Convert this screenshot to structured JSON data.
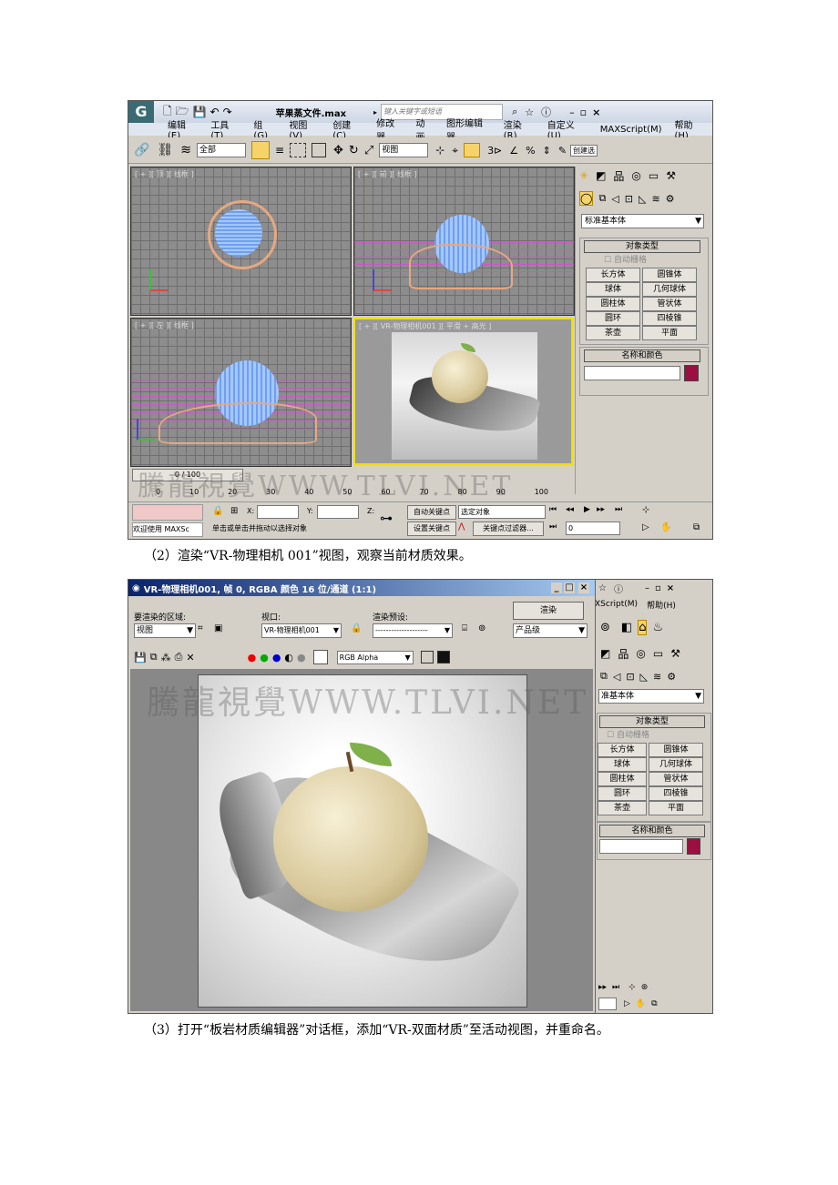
{
  "shot1": {
    "file_title": "苹果蒸文件.max",
    "search_placeholder": "键入关键字或短语",
    "menu": [
      "编辑(E)",
      "工具(T)",
      "组(G)",
      "视图(V)",
      "创建(C)",
      "修改器",
      "动画",
      "图形编辑器",
      "渲染(R)",
      "自定义(U)",
      "MAXScript(M)",
      "帮助(H)"
    ],
    "toolbar": {
      "select_filter": "全部",
      "view_select": "视图",
      "create_selection": "创建选"
    },
    "viewports": {
      "top": "[ + ][ 顶 ][ 线框 ]",
      "front": "[ + ][ 前 ][ 线框 ]",
      "left": "[ + ][ 左 ][ 线框 ]",
      "camera": "[ + ][ VR-物理相机001 ][ 平滑 + 高光 ]"
    },
    "panel": {
      "category": "标准基本体",
      "object_type_title": "对象类型",
      "autogrid": "自动栅格",
      "buttons": [
        "长方体",
        "圆锥体",
        "球体",
        "几何球体",
        "圆柱体",
        "管状体",
        "圆环",
        "四棱锥",
        "茶壶",
        "平面"
      ],
      "name_color_title": "名称和颜色"
    },
    "timeline": {
      "frame": "0 / 100",
      "ticks": [
        "0",
        "10",
        "20",
        "30",
        "40",
        "50",
        "60",
        "70",
        "80",
        "90",
        "100"
      ]
    },
    "status": {
      "welcome": "欢迎使用 MAXSc",
      "prompt": "单击或单击并拖动以选择对象",
      "x_label": "X:",
      "y_label": "Y:",
      "z_label": "Z:",
      "auto_key": "自动关键点",
      "set_key": "设置关键点",
      "selected": "选定对象",
      "key_filters": "关键点过滤器...",
      "frame_value": "0"
    }
  },
  "caption2": "（2）渲染“VR-物理相机 001”视图，观察当前材质效果。",
  "shot2": {
    "window_title": "VR-物理相机001, 帧 0, RGBA 颜色 16 位/通道 (1:1)",
    "render_area_label": "要渲染的区域:",
    "render_area_value": "视图",
    "viewport_label": "视口:",
    "viewport_value": "VR-物理相机001",
    "preset_label": "渲染预设:",
    "preset_value": "--------------------",
    "render_button": "渲染",
    "quality_value": "产品级",
    "channel_value": "RGB Alpha",
    "bg_panel": {
      "menu": [
        "XScript(M)",
        "帮助(H)"
      ],
      "category": "准基本体",
      "object_type_title": "对象类型",
      "autogrid": "自动栅格",
      "buttons": [
        "长方体",
        "圆锥体",
        "球体",
        "几何球体",
        "圆柱体",
        "管状体",
        "圆环",
        "四棱锥",
        "茶壶",
        "平面"
      ],
      "name_color_title": "名称和颜色"
    }
  },
  "caption3": "（3）打开“板岩材质编辑器”对话框，添加“VR-双面材质”至活动视图，并重命名。",
  "watermark": "騰龍視覺WWW.TLVI.NET",
  "colors": {
    "accent_selected": "#f0e000",
    "name_swatch": "#9b1040"
  }
}
